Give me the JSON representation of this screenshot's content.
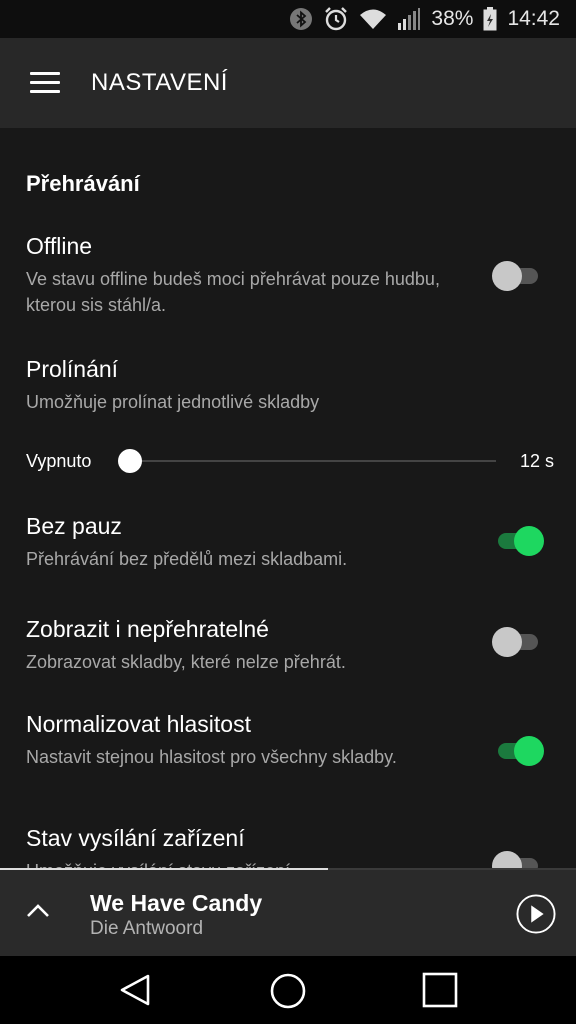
{
  "status_bar": {
    "battery_percent": "38%",
    "time": "14:42",
    "icons": [
      "bluetooth-icon",
      "alarm-icon",
      "wifi-icon",
      "signal-icon",
      "battery-icon"
    ]
  },
  "app_bar": {
    "title": "NASTAVENÍ",
    "menu_icon": "hamburger-menu-icon"
  },
  "section": {
    "title": "Přehrávání"
  },
  "settings": {
    "offline": {
      "title": "Offline",
      "desc": "Ve stavu offline budeš moci přehrávat pouze hudbu, kterou sis stáhl/a.",
      "enabled": false
    },
    "crossfade": {
      "title": "Prolínání",
      "desc": "Umožňuje prolínat jednotlivé skladby",
      "slider_min_label": "Vypnuto",
      "slider_max_label": "12 s",
      "value_fraction": 0.0
    },
    "gapless": {
      "title": "Bez pauz",
      "desc": "Přehrávání bez předělů mezi skladbami.",
      "enabled": true
    },
    "show_unplayable": {
      "title": "Zobrazit i nepřehratelné",
      "desc": "Zobrazovat skladby, které nelze přehrát.",
      "enabled": false
    },
    "normalize": {
      "title": "Normalizovat hlasitost",
      "desc": "Nastavit stejnou hlasitost pro všechny skladby.",
      "enabled": true
    },
    "device_broadcast": {
      "title": "Stav vysílání zařízení",
      "desc": "Umožňuje vysílání stavu zařízení",
      "enabled": false
    }
  },
  "now_playing": {
    "title": "We Have Candy",
    "artist": "Die Antwoord",
    "progress_fraction": 0.57
  },
  "colors": {
    "accent": "#1ed760",
    "background": "#181818",
    "app_bar": "#282828"
  }
}
